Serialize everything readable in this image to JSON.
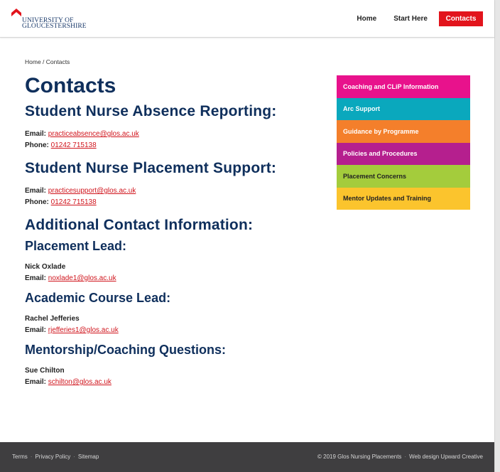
{
  "header": {
    "logo_line1": "UNIVERSITY OF",
    "logo_line2": "GLOUCESTERSHIRE",
    "nav": {
      "home": "Home",
      "start_here": "Start Here",
      "contacts": "Contacts"
    }
  },
  "breadcrumb": "Home / Contacts",
  "main": {
    "title": "Contacts",
    "absence": {
      "heading": "Student Nurse Absence Reporting:",
      "email_label": "Email:",
      "email": "practiceabsence@glos.ac.uk",
      "phone_label": "Phone:",
      "phone": "01242 715138"
    },
    "placement_support": {
      "heading": "Student Nurse Placement Support:",
      "email_label": "Email:",
      "email": "practicesupport@glos.ac.uk",
      "phone_label": "Phone:",
      "phone": "01242 715138"
    },
    "additional": {
      "heading": "Additional Contact Information:",
      "placement_lead": {
        "heading": "Placement Lead:",
        "name": "Nick Oxlade",
        "email_label": "Email:",
        "email": "noxlade1@glos.ac.uk"
      },
      "academic_lead": {
        "heading": "Academic Course Lead:",
        "name": "Rachel Jefferies",
        "email_label": "Email:",
        "email": "rjefferies1@glos.ac.uk"
      },
      "mentorship": {
        "heading": "Mentorship/Coaching Questions:",
        "name": "Sue Chilton",
        "email_label": "Email:",
        "email": "schilton@glos.ac.uk"
      }
    }
  },
  "sidebar": {
    "items": [
      {
        "label": "Coaching and CLiP Information",
        "color": "#e8128c"
      },
      {
        "label": "Arc Support",
        "color": "#0aa8bd"
      },
      {
        "label": "Guidance by Programme",
        "color": "#f47f2b"
      },
      {
        "label": "Policies and Procedures",
        "color": "#b51f8e"
      },
      {
        "label": "Placement Concerns",
        "color": "#a4cc3c"
      },
      {
        "label": "Mentor Updates and Training",
        "color": "#fbc42d"
      }
    ]
  },
  "footer": {
    "terms": "Terms",
    "privacy": "Privacy Policy",
    "sitemap": "Sitemap",
    "copyright": "© 2019 Glos Nursing Placements",
    "credit": "Web design Upward Creative"
  },
  "colors": {
    "brand_navy": "#0f2f5c",
    "accent_red": "#e2141c",
    "link_red": "#d0141c",
    "footer_bg": "#3f3e40"
  }
}
